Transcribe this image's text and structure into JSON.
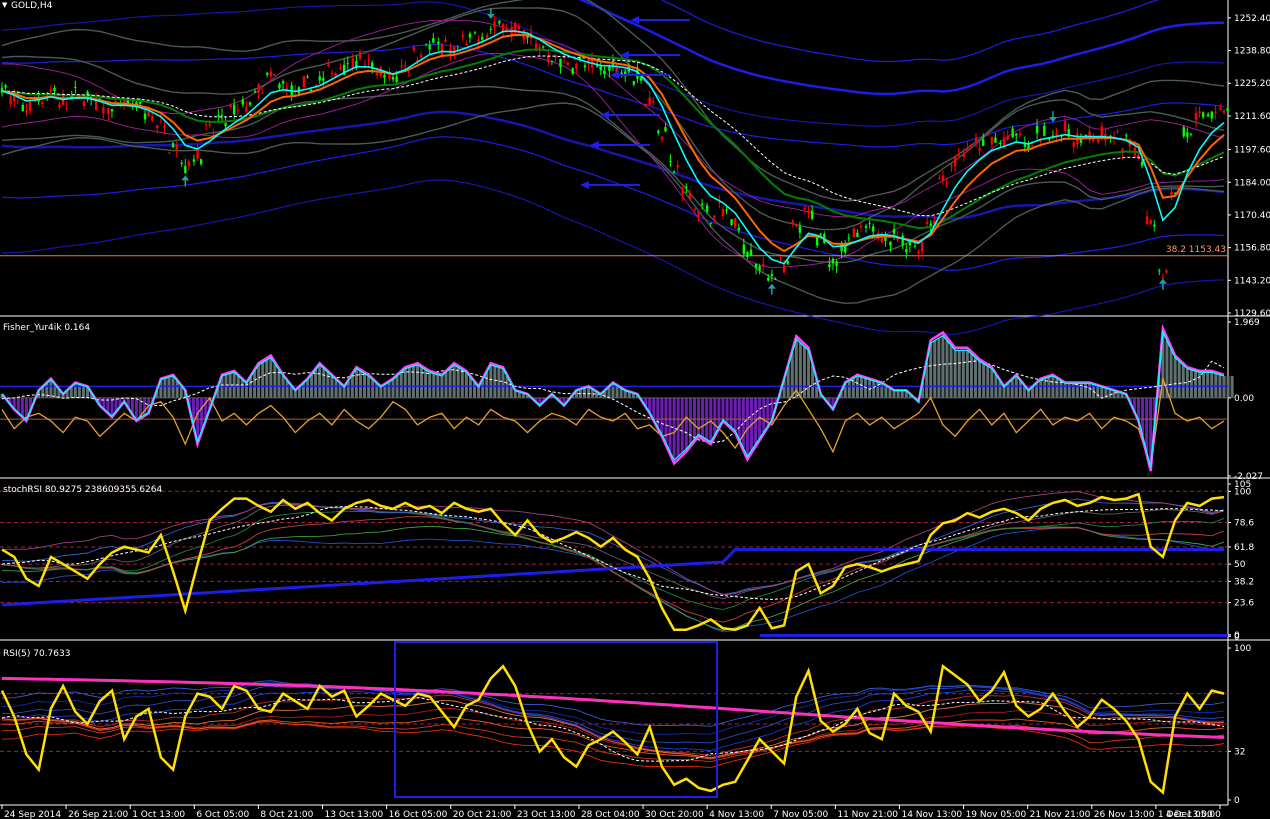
{
  "window": {
    "symbol_title": "GOLD,H4",
    "marker_glyph": "▼"
  },
  "panels": {
    "main": {
      "title": "GOLD,H4"
    },
    "fisher": {
      "title": "Fisher_Yur4ik 0.164"
    },
    "stochrsi": {
      "title": "stochRSI 80.9275 238609355.6264"
    },
    "rsi": {
      "title": "RSI(5) 70.7633"
    }
  },
  "fib_label": "38.2 1153.43",
  "colors": {
    "background": "#000000",
    "separator": "#ffffff",
    "price_bull": "#00ff00",
    "price_bear": "#ff0000",
    "ma_cyan": "#00ffff",
    "ma_orange": "#ff6600",
    "ma_green": "#008000",
    "band_blue": "#1e1ee6",
    "band_gray": "#4a5a55",
    "band_violet": "#a020a0",
    "arrow_teal": "#20a0a0",
    "fisher_magenta": "#ff44ff",
    "fisher_orange": "#e8a030",
    "hist_pos": "#607070",
    "hist_neg": "#6a1fb0",
    "rsi_yellow": "#ffe000",
    "rsi_magenta": "#ff30c0",
    "fib_line": "#ff9966"
  },
  "chart_data": [
    {
      "type": "line",
      "panel": "main",
      "title": "GOLD,H4",
      "ylim": [
        1129.6,
        1259.0
      ],
      "y_ticks": [
        "1252.40",
        "1238.80",
        "1225.20",
        "1211.60",
        "1197.60",
        "1184.00",
        "1170.40",
        "1156.80",
        "1143.20",
        "1129.60"
      ],
      "x_ticks": [
        "24 Sep 2014",
        "26 Sep 21:00",
        "1 Oct 13:00",
        "6 Oct 05:00",
        "8 Oct 21:00",
        "13 Oct 13:00",
        "16 Oct 05:00",
        "20 Oct 21:00",
        "23 Oct 13:00",
        "28 Oct 04:00",
        "30 Oct 20:00",
        "4 Nov 13:00",
        "7 Nov 05:00",
        "11 Nov 21:00",
        "14 Nov 13:00",
        "19 Nov 05:00",
        "21 Nov 21:00",
        "26 Nov 13:00",
        "1 Dec 13:00",
        "4 Dec 05:00"
      ],
      "series": [
        {
          "x": [
            0,
            1,
            2,
            3,
            4,
            5,
            6,
            7,
            8,
            9,
            10,
            11,
            12,
            13,
            14,
            15,
            16,
            17,
            18,
            19,
            20,
            21,
            22,
            23,
            24,
            25,
            26,
            27,
            28,
            29,
            30,
            31,
            32,
            33,
            34,
            35,
            36,
            37,
            38,
            39,
            40,
            41,
            42,
            43,
            44,
            45,
            46,
            47,
            48,
            49,
            50,
            51,
            52,
            53,
            54,
            55,
            56,
            57,
            58,
            59,
            60,
            61,
            62,
            63,
            64,
            65,
            66,
            67,
            68,
            69,
            70,
            71,
            72,
            73,
            74,
            75,
            76,
            77,
            78,
            79,
            80,
            81,
            82,
            83,
            84,
            85,
            86,
            87,
            88,
            89,
            90,
            91,
            92,
            93,
            94,
            95,
            96,
            97,
            98,
            99,
            100
          ],
          "values": [
            1222,
            1218,
            1215,
            1219,
            1221,
            1217,
            1220,
            1219,
            1216,
            1214,
            1216,
            1215,
            1212,
            1208,
            1200,
            1191,
            1196,
            1205,
            1210,
            1213,
            1216,
            1222,
            1227,
            1224,
            1221,
            1224,
            1226,
            1230,
            1233,
            1235,
            1232,
            1229,
            1227,
            1233,
            1238,
            1241,
            1240,
            1238,
            1242,
            1244,
            1247,
            1250,
            1247,
            1245,
            1240,
            1236,
            1234,
            1233,
            1232,
            1231,
            1232,
            1231,
            1228,
            1218,
            1205,
            1190,
            1180,
            1173,
            1171,
            1172,
            1166,
            1155,
            1148,
            1146,
            1148,
            1165,
            1170,
            1160,
            1152,
            1158,
            1162,
            1164,
            1163,
            1161,
            1158,
            1157,
            1168,
            1185,
            1193,
            1197,
            1199,
            1202,
            1201,
            1203,
            1199,
            1204,
            1204,
            1205,
            1202,
            1203,
            1203,
            1202,
            1200,
            1195,
            1168,
            1148,
            1180,
            1205,
            1210,
            1213,
            1214
          ]
        }
      ]
    },
    {
      "type": "line",
      "panel": "fisher",
      "title": "Fisher_Yur4ik 0.164",
      "ylim": [
        -2.027,
        1.969
      ],
      "y_ticks": [
        "1.969",
        "0.00",
        "-2.027"
      ],
      "series": [
        {
          "values": [
            0.1,
            -0.3,
            -0.6,
            0.2,
            0.5,
            0.1,
            0.4,
            0.3,
            -0.2,
            -0.5,
            -0.1,
            -0.6,
            -0.4,
            0.5,
            0.6,
            0.2,
            -1.2,
            -0.3,
            0.6,
            0.7,
            0.4,
            0.9,
            1.1,
            0.6,
            0.2,
            0.5,
            0.9,
            0.6,
            0.3,
            0.8,
            0.6,
            0.3,
            0.5,
            0.8,
            0.9,
            0.7,
            0.6,
            0.9,
            0.7,
            0.3,
            0.9,
            0.8,
            0.2,
            0.1,
            -0.2,
            0.1,
            -0.2,
            0.2,
            0.3,
            0.1,
            0.4,
            0.2,
            0.1,
            -0.4,
            -1.0,
            -1.7,
            -1.4,
            -1.0,
            -1.2,
            -0.6,
            -0.9,
            -1.6,
            -1.1,
            -0.6,
            0.5,
            1.6,
            1.3,
            0.1,
            -0.3,
            0.4,
            0.6,
            0.5,
            0.4,
            0.2,
            0.2,
            -0.1,
            1.5,
            1.7,
            1.3,
            1.3,
            1.0,
            0.8,
            0.3,
            0.6,
            0.2,
            0.5,
            0.6,
            0.4,
            0.4,
            0.4,
            0.3,
            0.2,
            0.1,
            -0.6,
            -1.9,
            1.8,
            1.1,
            0.8,
            0.7,
            0.7,
            0.6
          ]
        },
        {
          "values": [
            -0.3,
            -0.8,
            -0.5,
            -0.4,
            -0.6,
            -0.9,
            -0.5,
            -0.6,
            -1.0,
            -0.7,
            -0.4,
            -0.6,
            -0.2,
            -0.1,
            -0.5,
            -1.2,
            -0.4,
            0.0,
            -0.6,
            -0.4,
            -0.7,
            -0.4,
            -0.2,
            -0.5,
            -0.9,
            -0.6,
            -0.4,
            -0.7,
            -0.3,
            -0.6,
            -0.8,
            -0.5,
            -0.1,
            -0.3,
            -0.7,
            -0.5,
            -0.4,
            -0.8,
            -0.5,
            -0.7,
            -0.3,
            -0.5,
            -0.6,
            -0.9,
            -0.6,
            -0.4,
            -0.5,
            -0.7,
            -0.3,
            -0.5,
            -0.6,
            -0.4,
            -0.8,
            -0.7,
            -1.0,
            -0.9,
            -0.5,
            -0.8,
            -0.6,
            -0.9,
            -1.3,
            -0.8,
            -0.5,
            -0.7,
            -0.2,
            0.2,
            -0.3,
            -0.8,
            -1.4,
            -0.6,
            -0.4,
            -0.7,
            -0.5,
            -0.8,
            -0.6,
            -0.4,
            0.0,
            -0.7,
            -1.0,
            -0.6,
            -0.3,
            -0.7,
            -0.4,
            -0.9,
            -0.6,
            -0.3,
            -0.7,
            -0.5,
            -0.6,
            -0.4,
            -0.8,
            -0.5,
            -0.6,
            -0.8,
            -1.8,
            0.5,
            -0.4,
            -0.6,
            -0.5,
            -0.8,
            -0.6
          ]
        }
      ]
    },
    {
      "type": "line",
      "panel": "stochrsi",
      "title": "stochRSI 80.9275 238609355.6264",
      "ylim": [
        0,
        105
      ],
      "y_ticks": [
        "105",
        "100",
        "78.6",
        "61.8",
        "50",
        "38.2",
        "23.6",
        "0",
        "0"
      ],
      "series": [
        {
          "values": [
            60,
            55,
            40,
            35,
            55,
            50,
            45,
            40,
            50,
            58,
            62,
            60,
            58,
            70,
            45,
            18,
            50,
            80,
            88,
            95,
            95,
            90,
            86,
            94,
            88,
            92,
            85,
            80,
            88,
            92,
            94,
            90,
            88,
            92,
            88,
            90,
            85,
            92,
            88,
            86,
            88,
            78,
            70,
            80,
            70,
            65,
            68,
            72,
            68,
            62,
            68,
            60,
            55,
            40,
            20,
            5,
            5,
            8,
            12,
            6,
            5,
            8,
            20,
            6,
            8,
            45,
            50,
            30,
            35,
            48,
            50,
            48,
            45,
            48,
            50,
            52,
            70,
            78,
            80,
            85,
            82,
            86,
            88,
            85,
            80,
            88,
            92,
            94,
            90,
            92,
            96,
            94,
            95,
            98,
            62,
            55,
            80,
            92,
            90,
            95,
            96
          ]
        }
      ]
    },
    {
      "type": "line",
      "panel": "rsi",
      "title": "RSI(5) 70.7633",
      "ylim": [
        0,
        100
      ],
      "y_ticks": [
        "100",
        "32",
        "0"
      ],
      "series": [
        {
          "values": [
            72,
            55,
            30,
            20,
            60,
            75,
            58,
            50,
            65,
            72,
            40,
            55,
            60,
            28,
            20,
            55,
            70,
            68,
            60,
            75,
            72,
            60,
            58,
            70,
            65,
            60,
            75,
            68,
            72,
            55,
            62,
            70,
            66,
            62,
            70,
            68,
            58,
            48,
            62,
            66,
            80,
            88,
            75,
            50,
            32,
            40,
            28,
            22,
            36,
            40,
            45,
            38,
            30,
            48,
            22,
            10,
            14,
            8,
            6,
            10,
            12,
            26,
            40,
            32,
            24,
            68,
            85,
            52,
            45,
            50,
            60,
            44,
            40,
            70,
            62,
            58,
            45,
            88,
            82,
            76,
            65,
            72,
            84,
            62,
            55,
            60,
            70,
            58,
            48,
            55,
            66,
            60,
            52,
            40,
            12,
            5,
            55,
            70,
            60,
            72,
            70
          ]
        }
      ]
    }
  ]
}
